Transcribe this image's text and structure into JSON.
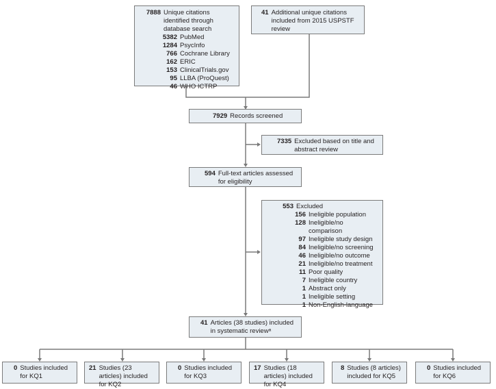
{
  "identification": {
    "database": {
      "count": "7888",
      "label": "Unique citations identified through database search",
      "sources": [
        {
          "count": "5382",
          "label": "PubMed"
        },
        {
          "count": "1284",
          "label": "PsycInfo"
        },
        {
          "count": "766",
          "label": "Cochrane Library"
        },
        {
          "count": "162",
          "label": "ERIC"
        },
        {
          "count": "153",
          "label": "ClinicalTrials.gov"
        },
        {
          "count": "95",
          "label": "LLBA (ProQuest)"
        },
        {
          "count": "46",
          "label": "WHO ICTRP"
        }
      ]
    },
    "additional": {
      "count": "41",
      "label": "Additional unique citations included from 2015 USPSTF review"
    }
  },
  "screened": {
    "count": "7929",
    "label": "Records screened"
  },
  "excluded_title_abstract": {
    "count": "7335",
    "label": "Excluded based on title and abstract review"
  },
  "full_text": {
    "count": "594",
    "label": "Full-text articles assessed for eligibility"
  },
  "excluded_full_text": {
    "count": "553",
    "label": "Excluded",
    "reasons": [
      {
        "count": "156",
        "label": "Ineligible population"
      },
      {
        "count": "128",
        "label": "Ineligible/no comparison"
      },
      {
        "count": "97",
        "label": "Ineligible study design"
      },
      {
        "count": "84",
        "label": "Ineligible/no screening"
      },
      {
        "count": "46",
        "label": "Ineligible/no outcome"
      },
      {
        "count": "21",
        "label": "Ineligible/no treatment"
      },
      {
        "count": "11",
        "label": "Poor quality"
      },
      {
        "count": "7",
        "label": "Ineligible country"
      },
      {
        "count": "1",
        "label": "Abstract only"
      },
      {
        "count": "1",
        "label": "Ineligible setting"
      },
      {
        "count": "1",
        "label": "Non-English-language"
      }
    ]
  },
  "included": {
    "count": "41",
    "label": "Articles (38 studies) included in systematic reviewᵃ"
  },
  "key_questions": [
    {
      "count": "0",
      "label": "Studies included for KQ1"
    },
    {
      "count": "21",
      "label": "Studies (23 articles) included for KQ2"
    },
    {
      "count": "0",
      "label": "Studies included for KQ3"
    },
    {
      "count": "17",
      "label": "Studies (18 articles) included for KQ4"
    },
    {
      "count": "8",
      "label": "Studies (8 articles) included for KQ5"
    },
    {
      "count": "0",
      "label": "Studies included for KQ6"
    }
  ]
}
